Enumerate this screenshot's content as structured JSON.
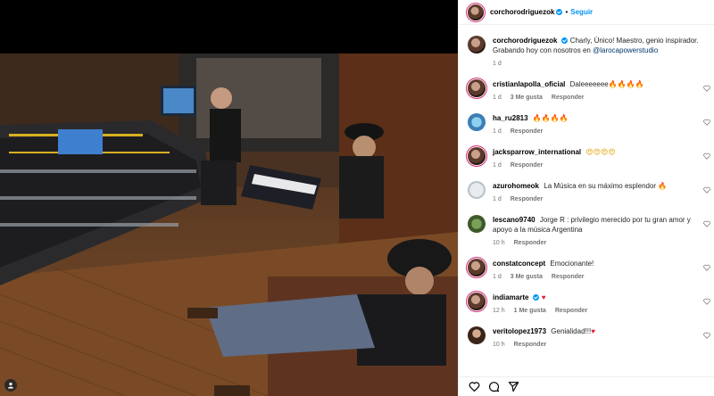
{
  "post": {
    "author": "corchorodriguezok",
    "follow_label": "Seguir",
    "caption": "Charly, Único! Maestro, genio inspirador. Grabando hoy con nosotros en",
    "caption_mention": "@larocapowerstudio",
    "time": "1 d"
  },
  "comments": [
    {
      "user": "cristianlapolla_oficial",
      "verified": false,
      "text": "Daleeeeeee",
      "emoji": "🔥🔥🔥🔥",
      "time": "1 d",
      "likes": "3 Me gusta",
      "reply": "Responder"
    },
    {
      "user": "ha_ru2813",
      "verified": false,
      "text": "",
      "emoji": "🔥🔥🔥🔥",
      "time": "1 d",
      "likes": "",
      "reply": "Responder"
    },
    {
      "user": "jacksparrow_international",
      "verified": false,
      "text": "",
      "emoji": "😍😍😍😍",
      "time": "1 d",
      "likes": "",
      "reply": "Responder"
    },
    {
      "user": "azurohomeok",
      "verified": false,
      "text": "La Música en su máximo esplendor",
      "emoji": "🔥",
      "time": "1 d",
      "likes": "",
      "reply": "Responder"
    },
    {
      "user": "lescano9740",
      "verified": false,
      "text": "Jorge R : privilegio merecido por tu gran amor y apoyo a la música Argentina",
      "emoji": "",
      "time": "10 h",
      "likes": "",
      "reply": "Responder"
    },
    {
      "user": "constatconcept",
      "verified": false,
      "text": "Emocionante!",
      "emoji": "",
      "time": "1 d",
      "likes": "3 Me gusta",
      "reply": "Responder"
    },
    {
      "user": "indiamarte",
      "verified": true,
      "text": "",
      "emoji": "♥",
      "time": "12 h",
      "likes": "1 Me gusta",
      "reply": "Responder"
    },
    {
      "user": "veritolopez1973",
      "verified": false,
      "text": "Genialidad!!!",
      "emoji": "♥",
      "time": "10 h",
      "likes": "",
      "reply": "Responder"
    }
  ],
  "colors": {
    "accent": "#0095f6",
    "mention": "#00376b"
  }
}
